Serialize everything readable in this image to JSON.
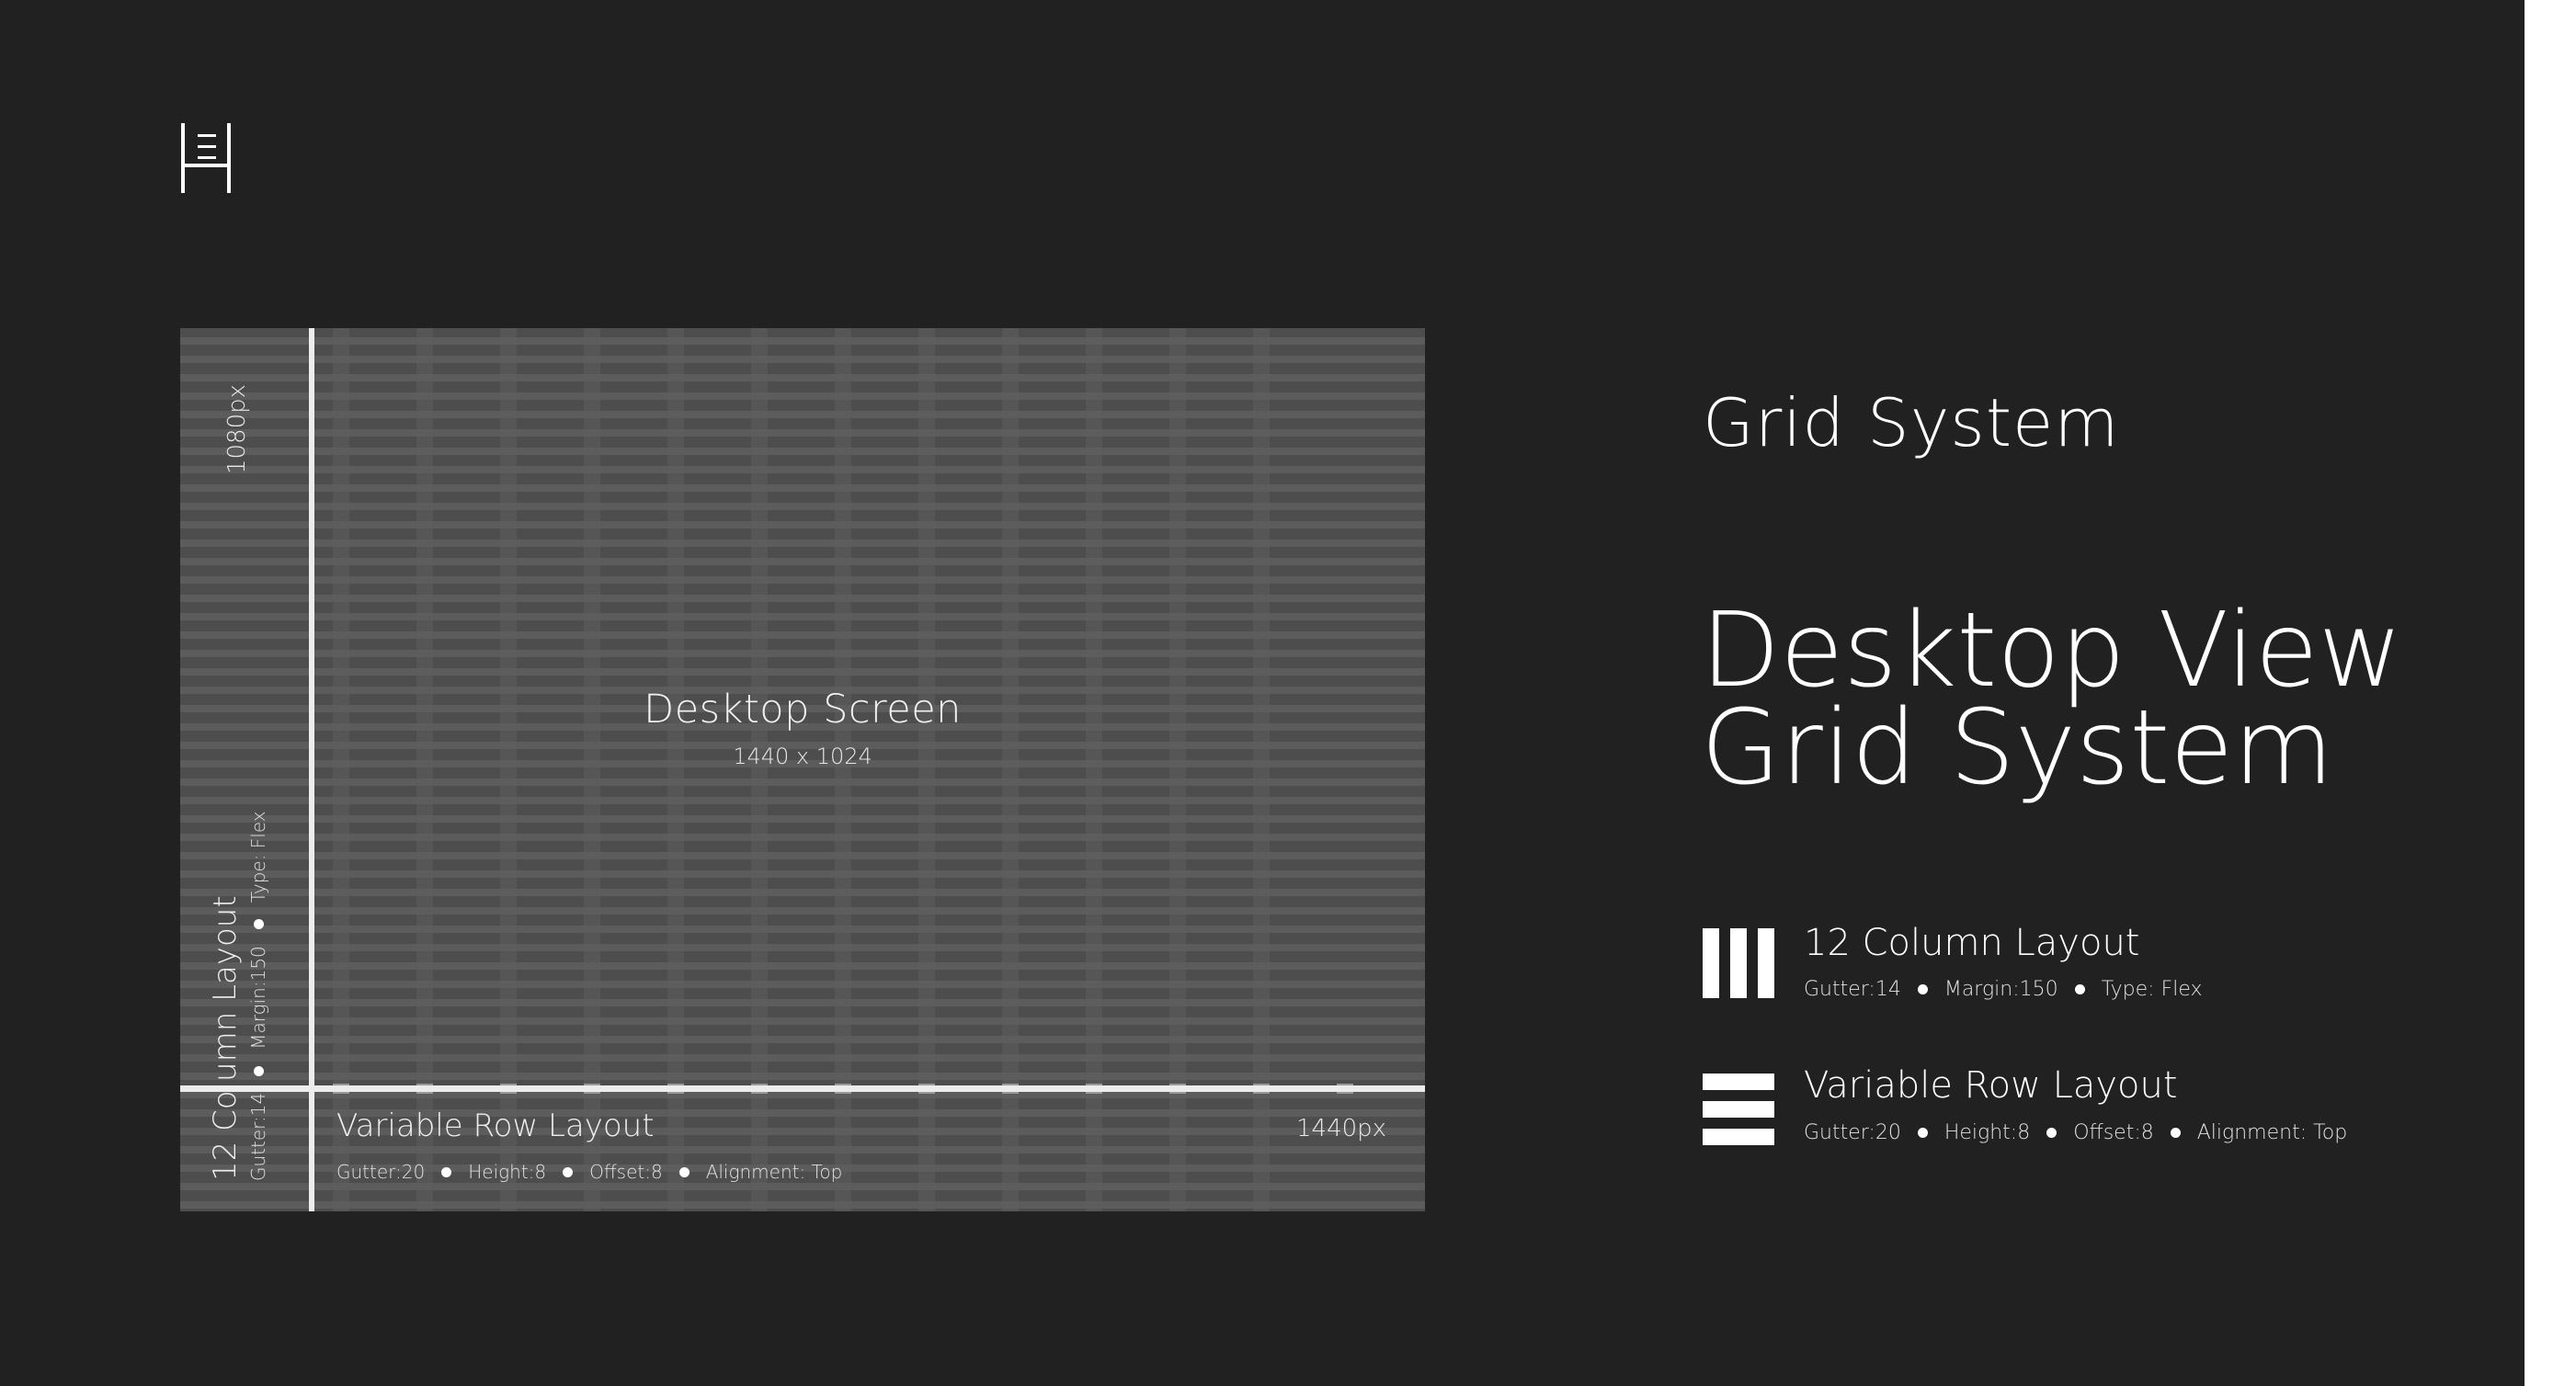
{
  "header": {
    "logo_name": "grid-logo-icon"
  },
  "diagram": {
    "screen_title": "Desktop Screen",
    "screen_size": "1440 x 1024",
    "width_label": "1440px",
    "height_label": "1080px",
    "column_layout": {
      "title": "12 Column Layout",
      "gutter": "Gutter:14",
      "margin": "Margin:150",
      "type": "Type: Flex"
    },
    "row_layout": {
      "title": "Variable Row Layout",
      "gutter": "Gutter:20",
      "height": "Height:8",
      "offset": "Offset:8",
      "alignment": "Alignment: Top"
    }
  },
  "side": {
    "heading_small": "Grid System",
    "heading_large_line1": "Desktop View",
    "heading_large_line2": "Grid System",
    "column_legend": {
      "title": "12 Column Layout",
      "gutter": "Gutter:14",
      "margin": "Margin:150",
      "type": "Type: Flex"
    },
    "row_legend": {
      "title": "Variable Row Layout",
      "gutter": "Gutter:20",
      "height": "Height:8",
      "offset": "Offset:8",
      "alignment": "Alignment: Top"
    }
  },
  "colors": {
    "background": "#212121",
    "panel": "#4d4d4d",
    "text": "#ffffff"
  }
}
